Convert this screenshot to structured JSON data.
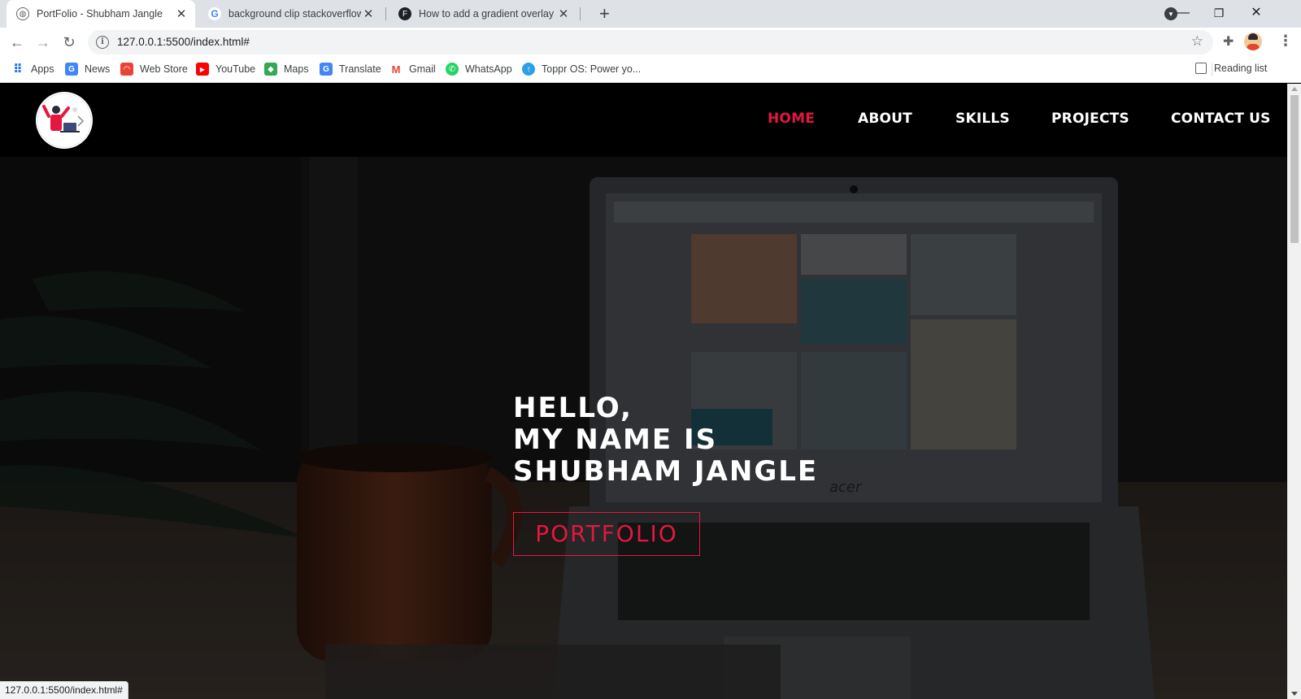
{
  "browser": {
    "tabs": [
      {
        "title": "PortFolio - Shubham Jangle",
        "icon": "globe-icon",
        "active": true
      },
      {
        "title": "background clip stackoverflow - G",
        "icon": "google-icon",
        "active": false
      },
      {
        "title": "How to add a gradient overlay to",
        "icon": "f-icon",
        "active": false
      }
    ],
    "url": "127.0.0.1:5500/index.html#",
    "bookmarks": [
      "Apps",
      "News",
      "Web Store",
      "YouTube",
      "Maps",
      "Translate",
      "Gmail",
      "WhatsApp",
      "Toppr OS: Power yo..."
    ],
    "reading_list": "Reading list",
    "status_url": "127.0.0.1:5500/index.html#"
  },
  "nav": {
    "links": [
      "HOME",
      "ABOUT",
      "SKILLS",
      "PROJECTS",
      "CONTACT US"
    ],
    "active": "HOME",
    "active_color": "#e5163f"
  },
  "hero": {
    "lines": [
      "HELLO,",
      "MY NAME IS",
      "SHUBHAM JANGLE"
    ],
    "button_label": "PORTFOLIO",
    "laptop_brand": "acer"
  },
  "colors": {
    "accent": "#e5163f",
    "navbar_bg": "#000000",
    "hero_text": "#ffffff"
  }
}
